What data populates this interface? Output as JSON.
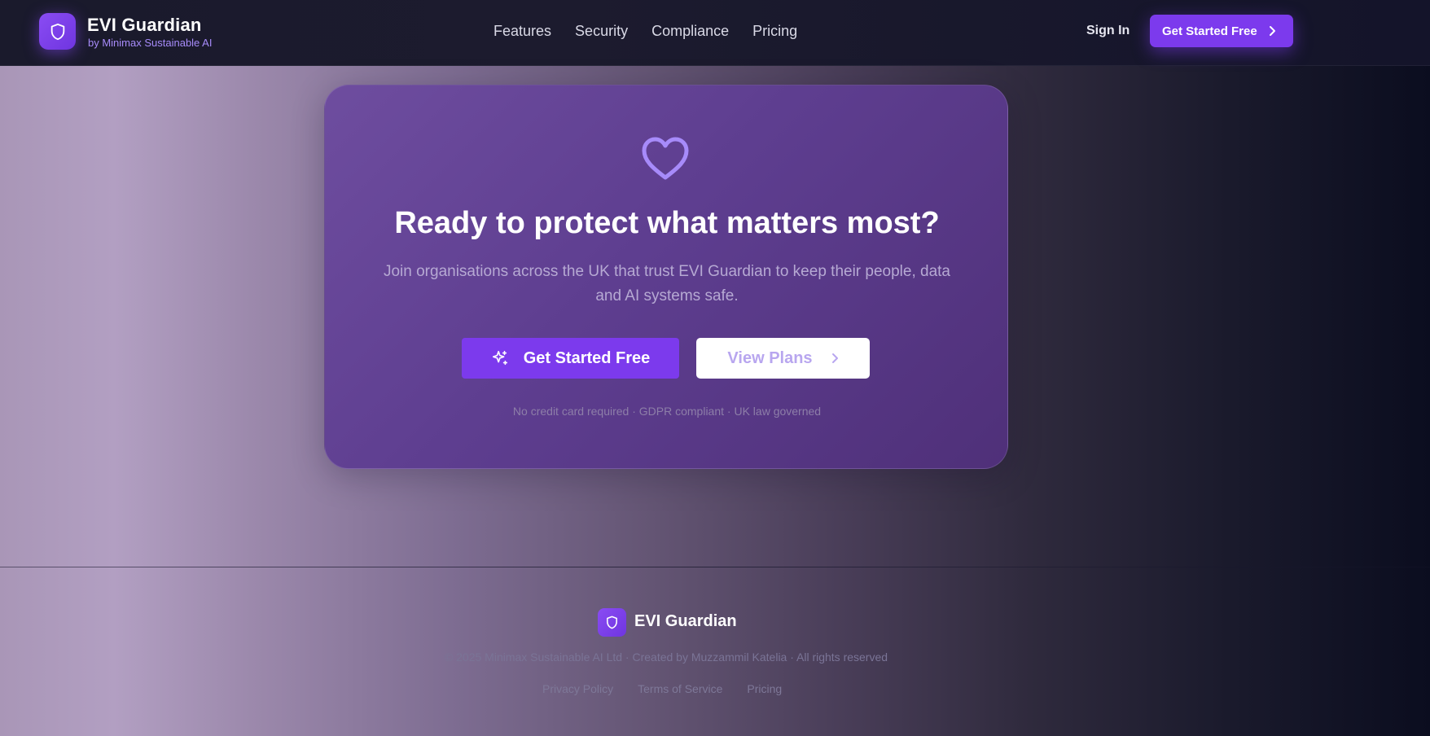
{
  "brand": {
    "name": "EVI Guardian",
    "tagline": "by Minimax Sustainable AI"
  },
  "nav": {
    "items": [
      {
        "label": "Features"
      },
      {
        "label": "Security"
      },
      {
        "label": "Compliance"
      },
      {
        "label": "Pricing"
      }
    ],
    "sign_in": "Sign In",
    "cta": "Get Started Free"
  },
  "cta_card": {
    "icon": "heart-icon",
    "title": "Ready to protect what matters most?",
    "description": "Join organisations across the UK that trust EVI Guardian to keep their people, data and AI systems safe.",
    "primary_button": "Get Started Free",
    "secondary_button": "View Plans",
    "note": "No credit card required · GDPR compliant · UK law governed"
  },
  "footer": {
    "brand": "EVI Guardian",
    "copyright": "© 2025 Minimax Sustainable AI Ltd · Created by Muzzammil Katelia · All rights reserved",
    "links": [
      {
        "label": "Privacy Policy"
      },
      {
        "label": "Terms of Service"
      },
      {
        "label": "Pricing"
      }
    ]
  },
  "colors": {
    "accent": "#7c3aed",
    "accent_light": "#a78bfa",
    "card": "#5e3e90"
  }
}
